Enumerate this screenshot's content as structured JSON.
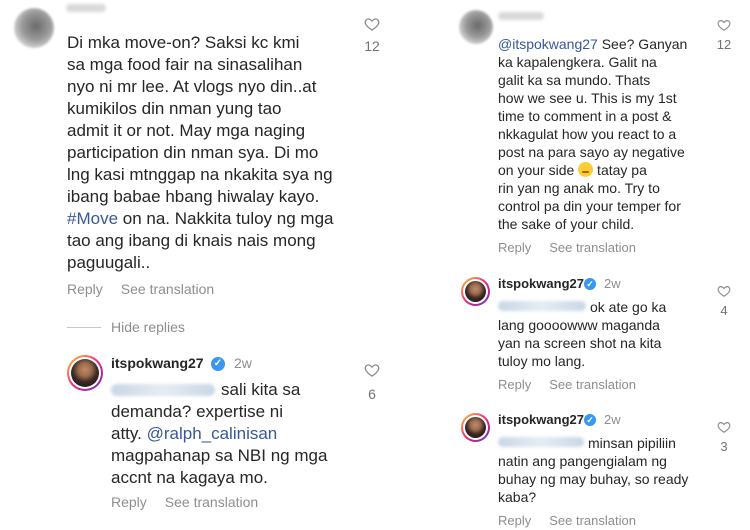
{
  "left": {
    "comment": {
      "text": "Di mka move-on? Saksi kc kmi\nsa mga food fair na sinasalihan\nnyo ni mr lee. At vlogs nyo din..at\nkumikilos din nman yung tao\nadmit it or not. May mga naging\nparticipation din nman sya. Di mo\nlng kasi mtnggap na nkakita sya ng\nibang babae hbang hiwalay kayo.",
      "hashtag": "#Move",
      "text_after": " on na. Nakkita tuloy ng mga\ntao ang ibang di knais nais mong\npaguugali..",
      "likes": "12",
      "reply_label": "Reply",
      "translation_label": "See translation"
    },
    "hide_replies": "Hide replies",
    "reply": {
      "username": "itspokwang27",
      "time": "2w",
      "text_line1": "sali kita sa",
      "text_rest": "demanda? expertise ni\natty. ",
      "mention": "@ralph_calinisan",
      "text_after": "\nmagpahanap sa NBI ng mga\naccnt na kagaya mo.",
      "likes": "6",
      "reply_label": "Reply",
      "translation_label": "See translation"
    }
  },
  "right": {
    "comment": {
      "mention": "@itspokwang27",
      "text": " See? Ganyan\nka kapalengkera. Galit na\ngalit ka sa mundo. Thats\nhow we see u. This is my 1st\ntime to comment in a post &\nnkkagulat how you react to a\npost na para sayo ay negative\non your side ",
      "text_after": " tatay pa\nrin yan ng anak mo. Try to\ncontrol pa din your temper for\nthe sake of your child.",
      "likes": "12",
      "reply_label": "Reply",
      "translation_label": "See translation"
    },
    "reply1": {
      "username": "itspokwang27",
      "time": "2w",
      "text_line1": "ok ate go ka",
      "text_rest": "lang goooowww maganda\nyan na screen shot na kita\ntuloy mo lang.",
      "likes": "4",
      "reply_label": "Reply",
      "translation_label": "See translation"
    },
    "reply2": {
      "username": "itspokwang27",
      "time": "2w",
      "text_line1": "minsan pipiliin",
      "text_rest": "natin ang pangengialam ng\nbuhay ng may buhay, so ready\nkaba?",
      "likes": "3",
      "reply_label": "Reply",
      "translation_label": "See translation"
    }
  },
  "colors": {
    "link": "#385898",
    "verified": "#3897f0",
    "muted": "#8e8e8e"
  },
  "icons": {
    "like": "heart-outline-icon",
    "verified": "verified-badge-icon"
  }
}
